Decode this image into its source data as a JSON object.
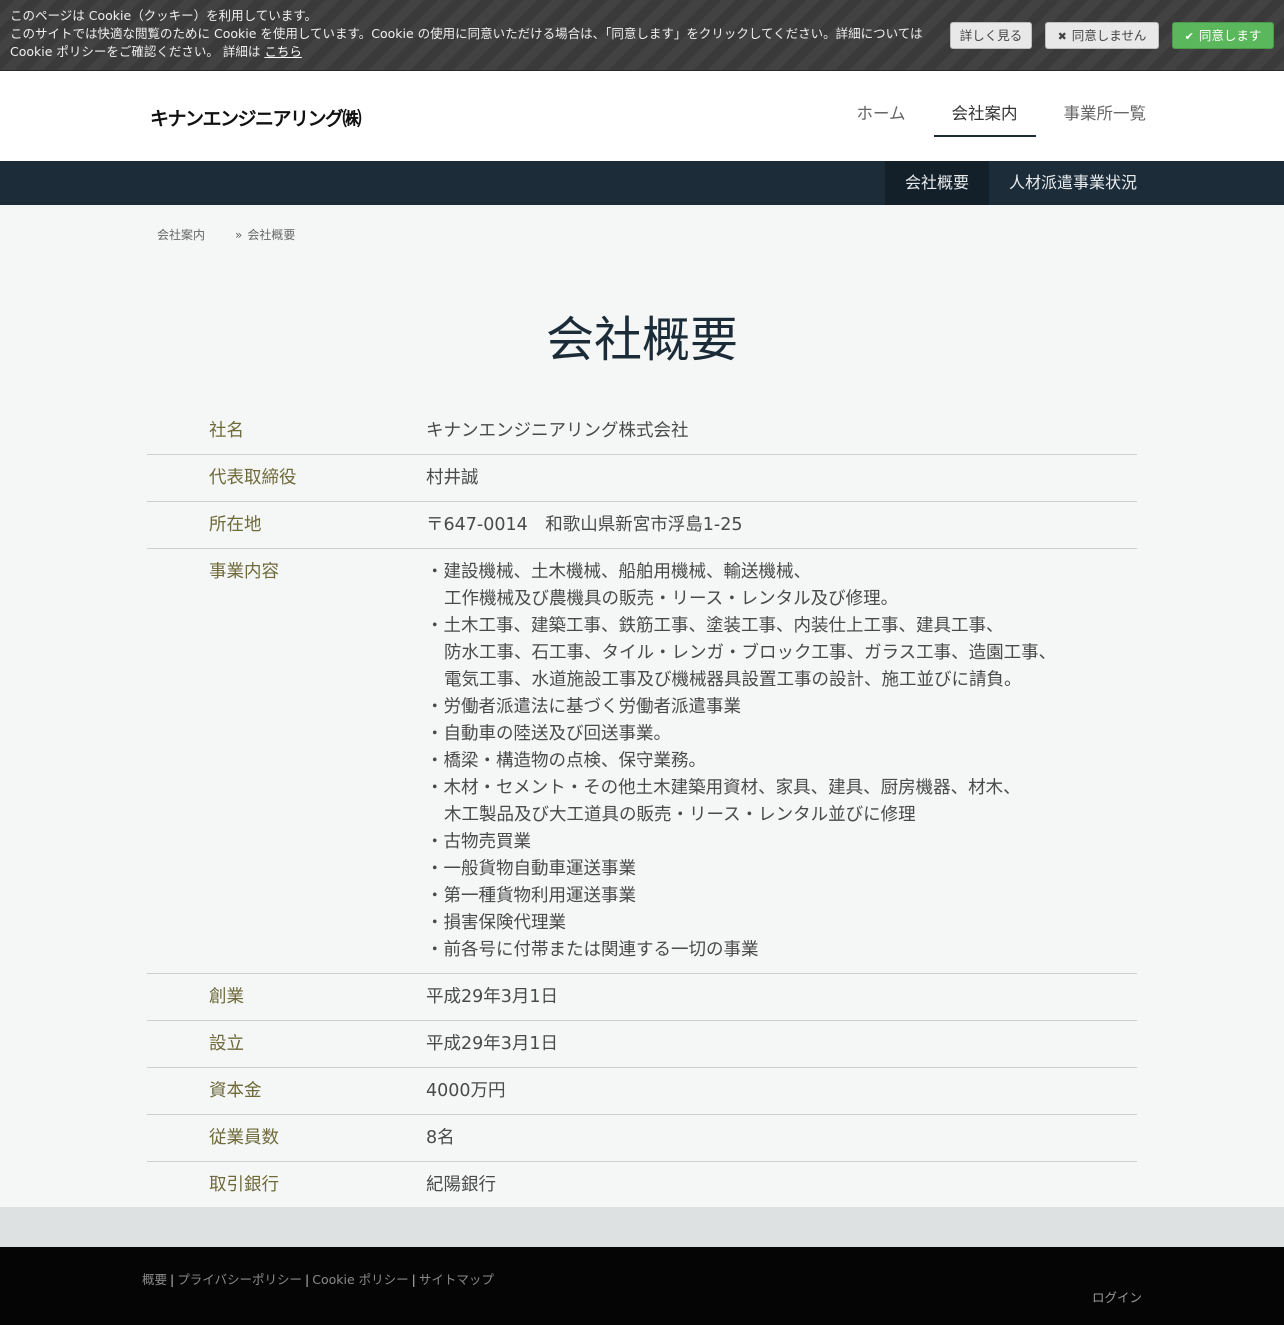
{
  "cookie": {
    "line1": "このページは Cookie（クッキー）を利用しています。",
    "line2": "このサイトでは快適な閲覧のために Cookie を使用しています。Cookie の使用に同意いただける場合は、「同意します」をクリックしてください。詳細については Cookie ポリシーをご確認ください。 詳細は",
    "link": "こちら",
    "more_label": "詳しく見る",
    "deny_label": "同意しません",
    "agree_label": "同意します",
    "deny_icon": "✖",
    "agree_icon": "✔"
  },
  "logo_text": "キナンエンジニアリング㈱",
  "nav": [
    "ホーム",
    "会社案内",
    "事業所一覧"
  ],
  "subnav": [
    "会社概要",
    "人材派遣事業状況"
  ],
  "breadcrumb": {
    "parent": "会社案内",
    "sep": "»",
    "current": "会社概要"
  },
  "page_title": "会社概要",
  "rows": [
    {
      "k": "社名",
      "v": "キナンエンジニアリング株式会社"
    },
    {
      "k": "代表取締役",
      "v": "村井誠"
    },
    {
      "k": "所在地",
      "v": "〒647-0014　和歌山県新宮市浮島1-25"
    }
  ],
  "business": {
    "k": "事業内容",
    "items": [
      "・建設機械、土木機械、船舶用機械、輸送機械、",
      "工作機械及び農機具の販売・リース・レンタル及び修理。",
      "・土木工事、建築工事、鉄筋工事、塗装工事、内装仕上工事、建具工事、",
      "防水工事、石工事、タイル・レンガ・ブロック工事、ガラス工事、造園工事、",
      "電気工事、水道施設工事及び機械器具設置工事の設計、施工並びに請負。",
      "・労働者派遣法に基づく労働者派遣事業",
      "・自動車の陸送及び回送事業。",
      "・橋梁・構造物の点検、保守業務。",
      "・木材・セメント・その他土木建築用資材、家具、建具、厨房機器、材木、",
      "木工製品及び大工道具の販売・リース・レンタル並びに修理",
      "・古物売買業",
      "・一般貨物自動車運送事業",
      "・第一種貨物利用運送事業",
      "・損害保険代理業",
      "・前各号に付帯または関連する一切の事業"
    ]
  },
  "rows2": [
    {
      "k": "創業",
      "v": "平成29年3月1日"
    },
    {
      "k": "設立",
      "v": "平成29年3月1日"
    },
    {
      "k": "資本金",
      "v": "4000万円"
    },
    {
      "k": "従業員数",
      "v": "8名"
    },
    {
      "k": "取引銀行",
      "v": "紀陽銀行"
    }
  ],
  "footer": {
    "links": [
      "概要",
      "プライバシーポリシー",
      "Cookie ポリシー",
      "サイトマップ"
    ],
    "sep": "|",
    "login": "ログイン"
  }
}
